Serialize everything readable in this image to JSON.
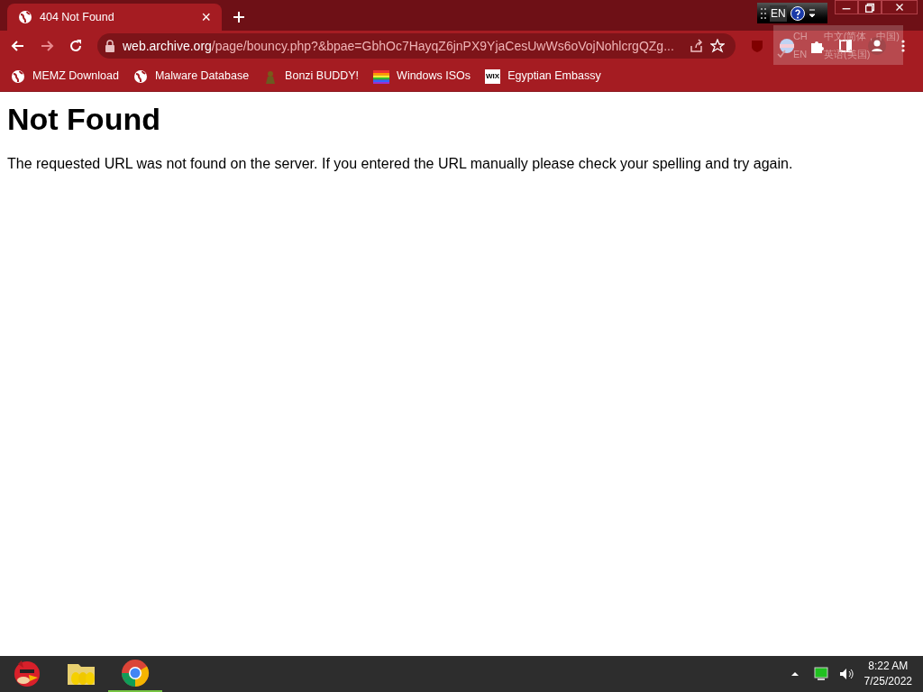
{
  "tabs": [
    {
      "title": "404 Not Found",
      "close": "×",
      "selected": true
    }
  ],
  "toolbar": {
    "back_disabled": false,
    "forward_disabled": true,
    "url_host": "web.archive.org",
    "url_path": "/page/bouncy.php?&bpae=GbhOc7HayqZ6jnPX9YjaCesUwWs6oVojNohlcrgQZg..."
  },
  "bookmarks": [
    {
      "kind": "globe",
      "label": "MEMZ Download"
    },
    {
      "kind": "globe",
      "label": "Malware Database"
    },
    {
      "kind": "figure",
      "label": "Bonzi BUDDY!"
    },
    {
      "kind": "rainbow",
      "label": "Windows ISOs"
    },
    {
      "kind": "wix",
      "badge": "WIX",
      "label": "Egyptian Embassy"
    }
  ],
  "language_bar": {
    "label": "EN",
    "menu": [
      {
        "code": "CH",
        "name": "中文(简体，中国)",
        "checked": false
      },
      {
        "code": "EN",
        "name": "英语(美国)",
        "checked": true
      }
    ]
  },
  "page": {
    "heading": "Not Found",
    "message": "The requested URL was not found on the server. If you entered the URL manually please check your spelling and try again."
  },
  "taskbar": {
    "apps": [
      {
        "kind": "bird",
        "active": false
      },
      {
        "kind": "folder",
        "active": false
      },
      {
        "kind": "chrome",
        "active": true
      }
    ],
    "time": "8:22 AM",
    "date": "7/25/2022"
  }
}
